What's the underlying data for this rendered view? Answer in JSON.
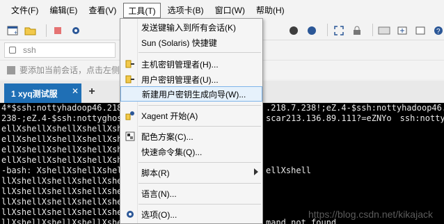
{
  "menubar": {
    "items": [
      "文件(F)",
      "编辑(E)",
      "查看(V)",
      "工具(T)",
      "选项卡(B)",
      "窗口(W)",
      "帮助(H)"
    ]
  },
  "address": {
    "value": "ssh"
  },
  "hint": {
    "text": "要添加当前会话，点击左侧"
  },
  "tab": {
    "label": "1 xyq测试服",
    "close": "✕"
  },
  "tab_add": "+",
  "terminal": {
    "lines": [
      "4*$ssh:nottyhadoop46.218",
      "238-;eZ.4-$ssh:nottyghos",
      "ellXshellXshellXshellXsh",
      "ellXshellXshellXshellXsh",
      "ellXshellXshellXshellXsh",
      "ellXshellXshellXshellXsh",
      "-bash: XshellXshellXshel",
      "llXshellXshellXshellXshe",
      "llXshellXshellXshellXshe",
      "llXshellXshellXshellXshe",
      "llXshellXshellXshellXshe",
      "llXshellXshellXshellXshe"
    ],
    "right_lines": [
      ".218.7.238!;eZ.4-$ssh:nottyhadoop46.",
      "scar213.136.89.111?=eZNYo　ssh:nottysqu",
      "",
      "",
      "",
      "",
      "ellXshell",
      "",
      "",
      "",
      "",
      "mand not found"
    ],
    "watermark": "https://blog.csdn.net/kikajack"
  },
  "dropdown": {
    "items": [
      {
        "label": "发送键输入到所有会话(K)",
        "icon": ""
      },
      {
        "label": "Sun (Solaris) 快捷键",
        "icon": ""
      },
      {
        "label": "主机密钥管理者(H)...",
        "icon": "key-icon"
      },
      {
        "label": "用户密钥管理者(U)...",
        "icon": "key-icon"
      },
      {
        "label": "新建用户密钥生成向导(W)...",
        "icon": ""
      },
      {
        "label": "Xagent 开始(A)",
        "icon": "agent-icon"
      },
      {
        "label": "配色方案(C)...",
        "icon": "color-scheme-icon"
      },
      {
        "label": "快速命令集(Q)...",
        "icon": ""
      },
      {
        "label": "脚本(R)",
        "icon": ""
      },
      {
        "label": "语言(N)...",
        "icon": ""
      },
      {
        "label": "选项(O)...",
        "icon": "gear-icon"
      }
    ]
  },
  "colors": {
    "tab_active": "#1f6fb5",
    "terminal_bg": "#000000",
    "menu_highlight": "#e6f1fb"
  }
}
